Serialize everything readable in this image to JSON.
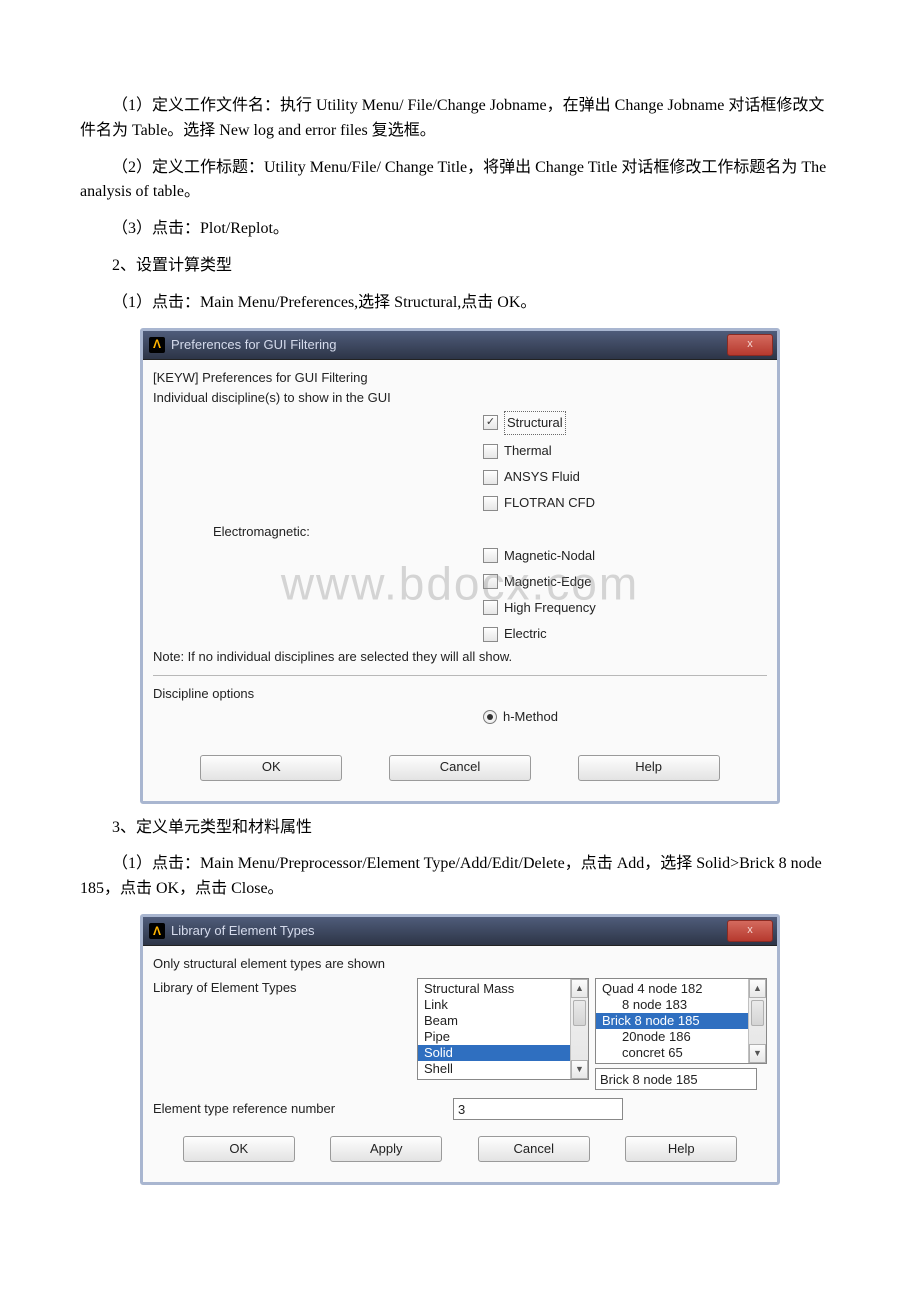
{
  "paragraphs": {
    "p1": "（1）定义工作文件名：执行 Utility Menu/ File/Change Jobname，在弹出 Change Jobname 对话框修改文件名为 Table。选择 New log and error files 复选框。",
    "p2": "（2）定义工作标题：Utility Menu/File/ Change Title，将弹出 Change Title 对话框修改工作标题名为 The analysis of table。",
    "p3": "（3）点击：Plot/Replot。",
    "p4": "2、设置计算类型",
    "p5": "（1）点击：Main Menu/Preferences,选择 Structural,点击 OK。",
    "p6": "3、定义单元类型和材料属性",
    "p7": "（1）点击：Main Menu/Preprocessor/Element Type/Add/Edit/Delete，点击 Add，选择 Solid>Brick 8 node 185，点击 OK，点击 Close。"
  },
  "watermark": "www.bdocx.com",
  "dlg1": {
    "title": "Preferences for GUI Filtering",
    "keyw": "[KEYW] Preferences for GUI Filtering",
    "individual": "Individual discipline(s) to show in the GUI",
    "opts": {
      "structural": "Structural",
      "thermal": "Thermal",
      "ansysfluid": "ANSYS Fluid",
      "flotran": "FLOTRAN CFD"
    },
    "emlabel": "Electromagnetic:",
    "emopts": {
      "magnodal": "Magnetic-Nodal",
      "magedge": "Magnetic-Edge",
      "highfreq": "High Frequency",
      "electric": "Electric"
    },
    "note": "Note: If no individual disciplines are selected they will all show.",
    "discopt": "Discipline options",
    "hmethod": "h-Method",
    "ok": "OK",
    "cancel": "Cancel",
    "help": "Help",
    "close": "x"
  },
  "dlg2": {
    "title": "Library of Element Types",
    "onlystruct": "Only structural element types are shown",
    "liblabel": "Library of Element Types",
    "list1": [
      "Structural Mass",
      "Link",
      "Beam",
      "Pipe",
      "Solid",
      "Shell"
    ],
    "list2": [
      "Quad  4 node 182",
      "8 node 183",
      "Brick 8 node 185",
      "20node 186",
      "concret 65"
    ],
    "selected2": "Brick 8 node 185",
    "refnumlabel": "Element type reference number",
    "refnum": "3",
    "ok": "OK",
    "apply": "Apply",
    "cancel": "Cancel",
    "help": "Help",
    "close": "x"
  }
}
